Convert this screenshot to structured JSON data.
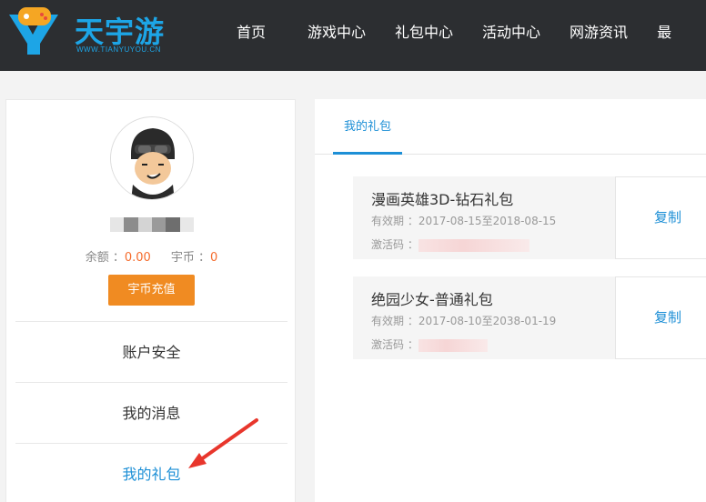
{
  "header": {
    "logo_text": "天宇游",
    "logo_sub": "WWW.TIANYUYOU.CN",
    "nav": [
      "首页",
      "游戏中心",
      "礼包中心",
      "活动中心",
      "网游资讯",
      "最"
    ]
  },
  "profile": {
    "balance_label": "余额 ：",
    "balance_value": "0.00",
    "coin_label": "宇币 ：",
    "coin_value": "0",
    "recharge_label": "宇币充值"
  },
  "menu": {
    "items": [
      "账户安全",
      "我的消息",
      "我的礼包"
    ],
    "active_index": 2
  },
  "tabs": {
    "active_label": "我的礼包"
  },
  "gifts": [
    {
      "title": "漫画英雄3D-钻石礼包",
      "validity_label": "有效期 ：",
      "validity_value": "2017-08-15至2018-08-15",
      "code_label": "激活码 ：",
      "copy_label": "复制"
    },
    {
      "title": "绝园少女-普通礼包",
      "validity_label": "有效期 ：",
      "validity_value": "2017-08-10至2038-01-19",
      "code_label": "激活码 ：",
      "copy_label": "复制"
    }
  ],
  "colors": {
    "header_bg": "#2c2e31",
    "accent_blue": "#1d8fd6",
    "recharge_orange": "#f08b22",
    "value_red": "#f56c2d",
    "arrow_red": "#e8362c"
  }
}
